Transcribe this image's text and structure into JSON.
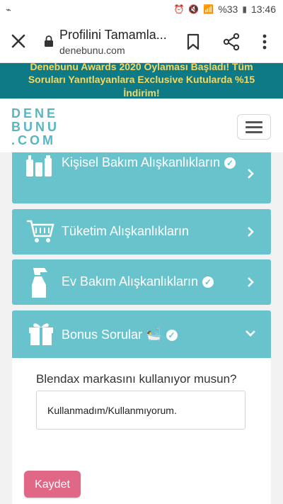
{
  "status_bar": {
    "time": "13:46",
    "battery": "%33"
  },
  "browser": {
    "title": "Profilini Tamamla...",
    "url": "denebunu.com"
  },
  "banner": {
    "line1": "Denebunu Awards 2020 Oylaması Başladı! Tüm",
    "line2": "Soruları Yanıtlayanlara Exclusive Kutularda %15",
    "line3": "İndirim!"
  },
  "logo": {
    "line1": "DENE",
    "line2": "BUNU",
    "line3": ".COM"
  },
  "sections": [
    {
      "label": "Kişisel Bakım Alışkanlıkların",
      "icon": "personal-care-icon",
      "completed": true
    },
    {
      "label": "Tüketim Alışkanlıkların",
      "icon": "shopping-cart-icon",
      "completed": false
    },
    {
      "label": "Ev Bakım Alışkanlıkların",
      "icon": "spray-bottle-icon",
      "completed": true
    },
    {
      "label": "Bonus Sorular",
      "icon": "gift-icon",
      "completed": true,
      "expanded": true
    }
  ],
  "bonus": {
    "question": "Blendax markasını kullanıyor musun?",
    "answer": "Kullanmadım/Kullanmıyorum.",
    "emoji": "🛀"
  },
  "save_label": "Kaydet",
  "colors": {
    "accent": "#69c3cd",
    "banner_bg": "#0d7a86",
    "banner_text": "#f6d860",
    "save": "#e06886"
  }
}
